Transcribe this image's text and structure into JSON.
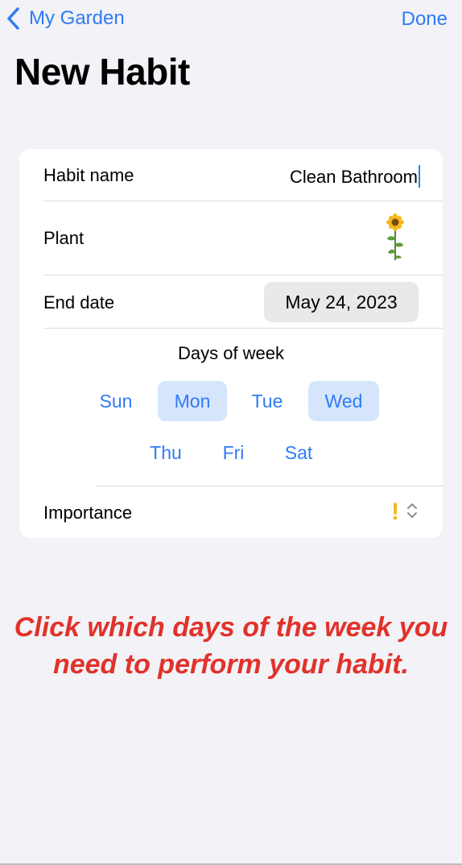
{
  "nav": {
    "back_label": "My Garden",
    "done_label": "Done"
  },
  "page": {
    "title": "New Habit"
  },
  "form": {
    "habit_name_label": "Habit name",
    "habit_name_value": "Clean Bathroom",
    "plant_label": "Plant",
    "plant_icon": "sunflower-icon",
    "end_date_label": "End date",
    "end_date_value": "May 24, 2023",
    "days_title": "Days of week",
    "days": [
      {
        "label": "Sun",
        "selected": false
      },
      {
        "label": "Mon",
        "selected": true
      },
      {
        "label": "Tue",
        "selected": false
      },
      {
        "label": "Wed",
        "selected": true
      },
      {
        "label": "Thu",
        "selected": false
      },
      {
        "label": "Fri",
        "selected": false
      },
      {
        "label": "Sat",
        "selected": false
      }
    ],
    "importance_label": "Importance",
    "importance_value": "!"
  },
  "instruction": {
    "text": "Click which days of the week you need to perform your habit."
  },
  "colors": {
    "accent": "#2f7bf5",
    "selected_day_bg": "#d5e5fb",
    "background": "#f2f2f7",
    "instruction": "#e1322a",
    "importance": "#f3b71b"
  }
}
